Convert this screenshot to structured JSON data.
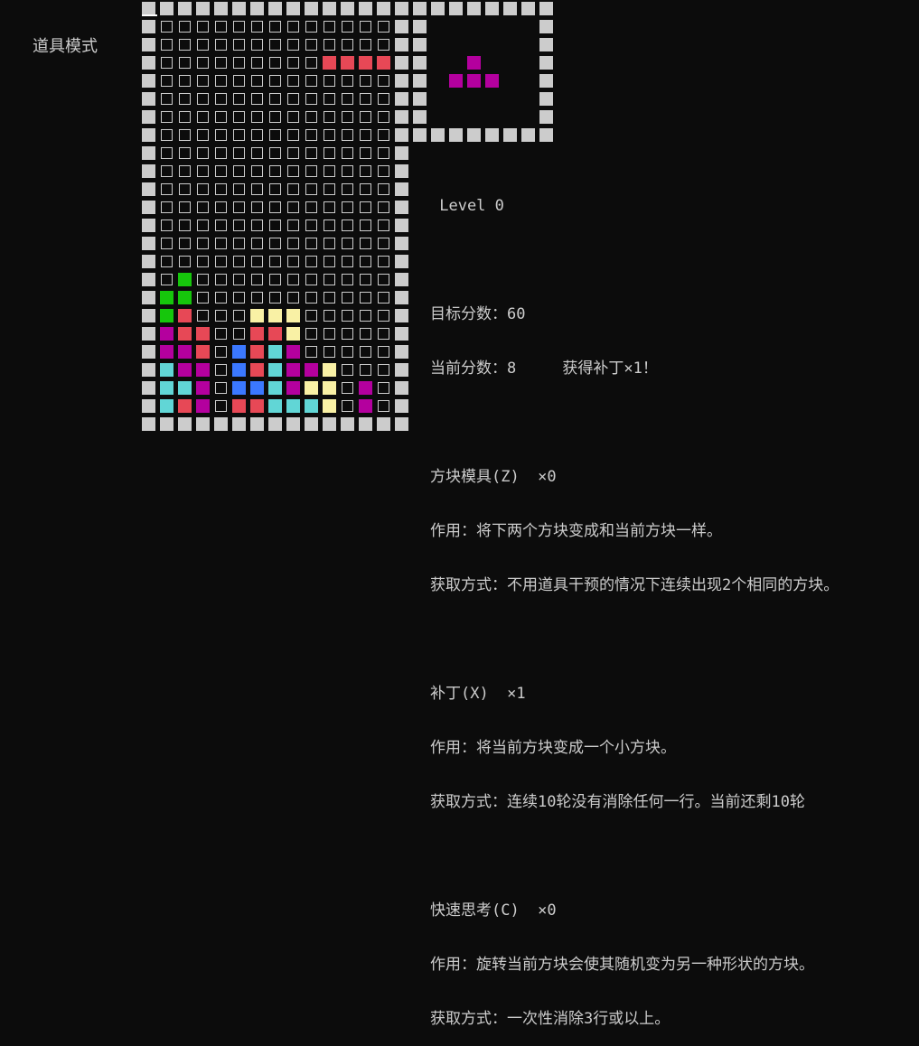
{
  "mode_label": "道具模式",
  "colors": {
    "W": "#cccccc",
    "R": "#e74856",
    "G": "#16c60c",
    "Y": "#f9f1a5",
    "M": "#b4009e",
    "C": "#61d6d6",
    "B": "#3b78ff"
  },
  "board_rows": [
    "WWWWWWWWWWWWWWW",
    "W.............W",
    "W.............W",
    "W.........RRRRW",
    "W.............W",
    "W.............W",
    "W.............W",
    "W.............W",
    "W.............W",
    "W.............W",
    "W.............W",
    "W.............W",
    "W.............W",
    "W.............W",
    "W.............W",
    "W.G...........W",
    "WGG...........W",
    "WGR...YYY.....W",
    "WMRR..RRY.....W",
    "WMMR.BRCM.....W",
    "WCMM.BRCMMY...W",
    "WCCM.BBCMYY.M.W",
    "WCRM.RRCCCY.M.W",
    "WWWWWWWWWWWWWWW"
  ],
  "preview_rows": [
    "WWWWWWWW",
    "W      W",
    "W      W",
    "W  M   W",
    "W MMM  W",
    "W      W",
    "W      W",
    "WWWWWWWW"
  ],
  "info": {
    "level": " Level 0",
    "target_score": "目标分数：60",
    "current_score": "当前分数：8     获得补丁×1！",
    "items": [
      {
        "title": "方块模具(Z)  ×0",
        "effect": "作用：将下两个方块变成和当前方块一样。",
        "obtain": "获取方式：不用道具干预的情况下连续出现2个相同的方块。"
      },
      {
        "title": "补丁(X)  ×1",
        "effect": "作用：将当前方块变成一个小方块。",
        "obtain": "获取方式：连续10轮没有消除任何一行。当前还剩10轮"
      },
      {
        "title": "快速思考(C)  ×0",
        "effect": "作用：旋转当前方块会使其随机变为另一种形状的方块。",
        "obtain": "获取方式：一次性消除3行或以上。"
      }
    ]
  }
}
